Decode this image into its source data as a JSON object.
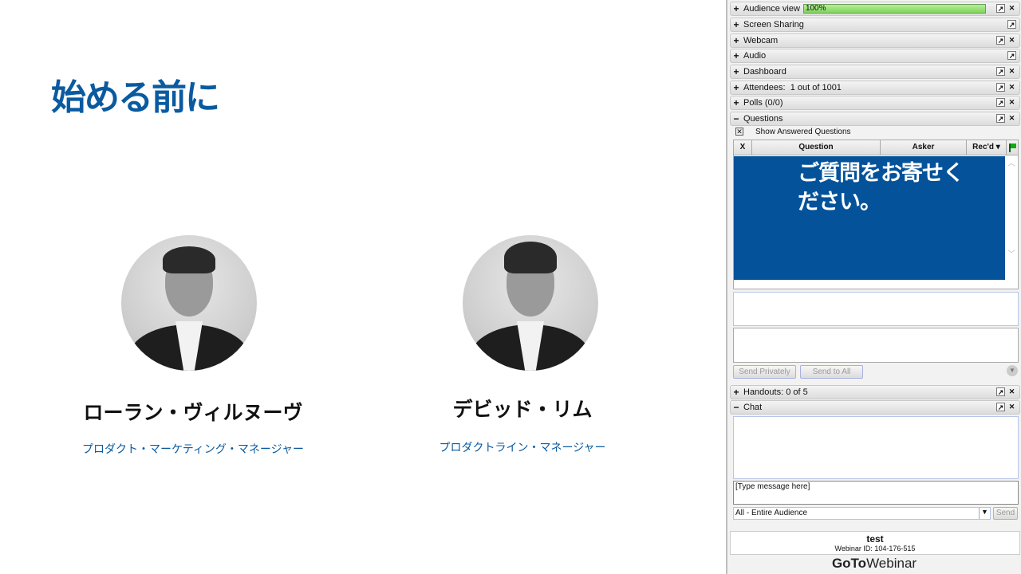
{
  "slide": {
    "title": "始める前に",
    "speakers": [
      {
        "name": "ローラン・ヴィルヌーヴ",
        "role": "プロダクト・マーケティング・マネージャー"
      },
      {
        "name": "デビッド・リム",
        "role": "プロダクトライン・マネージャー"
      }
    ]
  },
  "panel": {
    "sections": [
      {
        "label": "Audience view",
        "progress": "100%"
      },
      {
        "label": "Screen Sharing"
      },
      {
        "label": "Webcam"
      },
      {
        "label": "Audio"
      },
      {
        "label": "Dashboard"
      },
      {
        "label": "Attendees:  1 out of 1001"
      },
      {
        "label": "Polls (0/0)"
      },
      {
        "label": "Questions"
      }
    ],
    "questions": {
      "show_answered": "Show Answered Questions",
      "columns": [
        "X",
        "Question",
        "Asker",
        "Rec'd"
      ],
      "overlay": "ご質問をお寄せください。",
      "send_privately": "Send Privately",
      "send_to_all": "Send to All"
    },
    "handouts": "Handouts: 0 of 5",
    "chat": {
      "label": "Chat",
      "placeholder": "[Type message here]",
      "recipient": "All - Entire Audience",
      "send": "Send"
    },
    "footer": {
      "name": "test",
      "webinar_id": "Webinar ID: 104-176-515",
      "logo_bold": "GoTo",
      "logo_light": "Webinar"
    }
  }
}
